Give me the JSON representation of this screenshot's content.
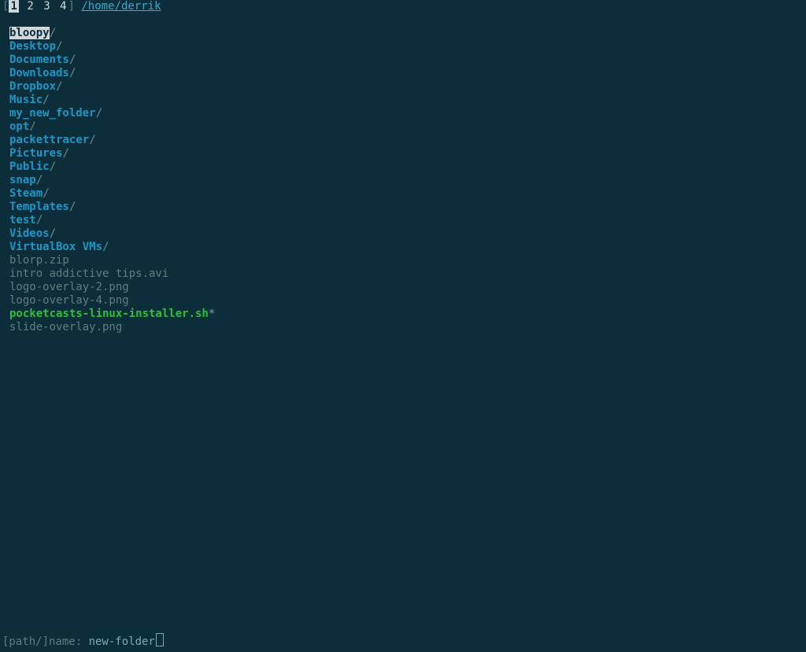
{
  "tabs": {
    "items": [
      "1",
      "2",
      "3",
      "4"
    ],
    "activeIndex": 0
  },
  "path": "/home/derrik",
  "entries": [
    {
      "name": "bloopy",
      "type": "dir",
      "selected": true
    },
    {
      "name": "Desktop",
      "type": "dir"
    },
    {
      "name": "Documents",
      "type": "dir"
    },
    {
      "name": "Downloads",
      "type": "dir"
    },
    {
      "name": "Dropbox",
      "type": "dir"
    },
    {
      "name": "Music",
      "type": "dir"
    },
    {
      "name": "my_new_folder",
      "type": "dir"
    },
    {
      "name": "opt",
      "type": "dir"
    },
    {
      "name": "packettracer",
      "type": "dir"
    },
    {
      "name": "Pictures",
      "type": "dir"
    },
    {
      "name": "Public",
      "type": "dir"
    },
    {
      "name": "snap",
      "type": "dir"
    },
    {
      "name": "Steam",
      "type": "dir"
    },
    {
      "name": "Templates",
      "type": "dir"
    },
    {
      "name": "test",
      "type": "dir"
    },
    {
      "name": "Videos",
      "type": "dir"
    },
    {
      "name": "VirtualBox VMs",
      "type": "dir"
    },
    {
      "name": "blorp.zip",
      "type": "file"
    },
    {
      "name": "intro addictive tips.avi",
      "type": "file"
    },
    {
      "name": "logo-overlay-2.png",
      "type": "file"
    },
    {
      "name": "logo-overlay-4.png",
      "type": "file"
    },
    {
      "name": "pocketcasts-linux-installer.sh",
      "type": "exec"
    },
    {
      "name": "slide-overlay.png",
      "type": "file"
    }
  ],
  "prompt": {
    "label": "[path/]name: ",
    "value": "new-folder"
  }
}
